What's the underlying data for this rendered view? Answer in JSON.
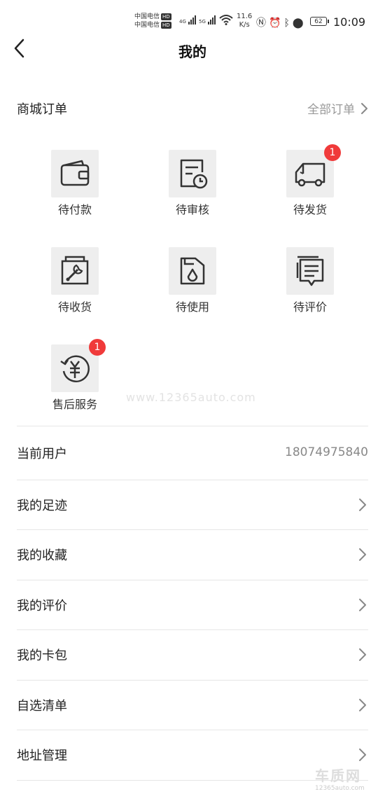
{
  "status_bar": {
    "carrier_1": "中国电信",
    "carrier_2": "中国电信",
    "hd": "HD",
    "sim1_net": "4G",
    "sim2_net": "5G",
    "wifi_tag": "6",
    "speed_value": "11.6",
    "speed_unit": "K/s",
    "battery": "62",
    "time": "10:09"
  },
  "header": {
    "title": "我的"
  },
  "orders": {
    "title": "商城订单",
    "all_label": "全部订单",
    "items": [
      {
        "label": "待付款",
        "icon": "wallet-icon",
        "badge": ""
      },
      {
        "label": "待审核",
        "icon": "document-clock-icon",
        "badge": ""
      },
      {
        "label": "待发货",
        "icon": "truck-icon",
        "badge": "1"
      },
      {
        "label": "待收货",
        "icon": "wrench-box-icon",
        "badge": ""
      },
      {
        "label": "待使用",
        "icon": "oil-can-icon",
        "badge": ""
      },
      {
        "label": "待评价",
        "icon": "comment-list-icon",
        "badge": ""
      },
      {
        "label": "售后服务",
        "icon": "yuan-refund-icon",
        "badge": "1"
      }
    ]
  },
  "watermark": "www.12365auto.com",
  "current_user": {
    "label": "当前用户",
    "value": "18074975840"
  },
  "menu": [
    {
      "label": "我的足迹"
    },
    {
      "label": "我的收藏"
    },
    {
      "label": "我的评价"
    },
    {
      "label": "我的卡包"
    },
    {
      "label": "自选清单"
    },
    {
      "label": "地址管理"
    }
  ],
  "corner_logo": {
    "big": "车质网",
    "small": "12365auto.com"
  },
  "colors": {
    "badge": "#f03a3a",
    "icon_bg": "#eeeeee",
    "muted": "#999999"
  }
}
